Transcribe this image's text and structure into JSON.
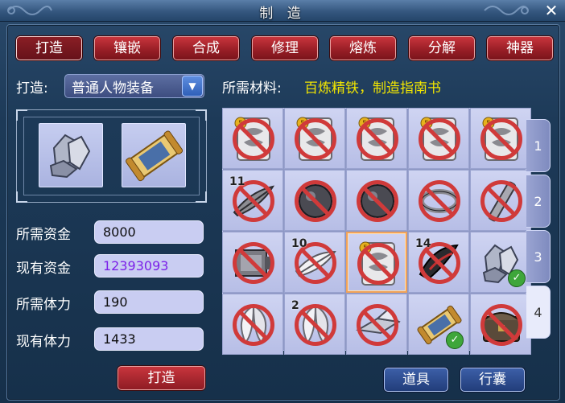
{
  "window": {
    "title": "制 造",
    "close_glyph": "✕"
  },
  "tabs": [
    {
      "label": "打造",
      "active": true
    },
    {
      "label": "镶嵌",
      "active": false
    },
    {
      "label": "合成",
      "active": false
    },
    {
      "label": "修理",
      "active": false
    },
    {
      "label": "熔炼",
      "active": false
    },
    {
      "label": "分解",
      "active": false
    },
    {
      "label": "神器",
      "active": false
    }
  ],
  "forge": {
    "type_label": "打造:",
    "type_value": "普通人物装备",
    "dropdown_icon": "chevron-down-icon",
    "materials_label": "所需材料:",
    "materials_value": "百炼精铁，制造指南书",
    "material_slots": [
      {
        "item": "refined-iron-icon"
      },
      {
        "item": "manufacturing-guide-scroll-icon"
      }
    ]
  },
  "stats": [
    {
      "label": "所需资金",
      "value": "8000",
      "color": "#0d0d0d"
    },
    {
      "label": "现有资金",
      "value": "12393093",
      "color": "#7b1fe8"
    },
    {
      "label": "所需体力",
      "value": "190",
      "color": "#0d0d0d"
    },
    {
      "label": "现有体力",
      "value": "1433",
      "color": "#0d0d0d"
    }
  ],
  "inventory": {
    "pages": [
      "1",
      "2",
      "3",
      "4"
    ],
    "active_page": "4",
    "rows": [
      [
        {
          "item": "medal-card-icon",
          "blocked": true,
          "count": ""
        },
        {
          "item": "medal-card-icon",
          "blocked": true,
          "count": ""
        },
        {
          "item": "medal-card-icon",
          "blocked": true,
          "count": ""
        },
        {
          "item": "medal-card-icon",
          "blocked": true,
          "count": ""
        },
        {
          "item": "medal-card-icon",
          "blocked": true,
          "count": ""
        }
      ],
      [
        {
          "item": "feather-icon",
          "blocked": true,
          "count": "11"
        },
        {
          "item": "dark-orb-icon",
          "blocked": true,
          "count": ""
        },
        {
          "item": "dark-orb-icon",
          "blocked": true,
          "count": ""
        },
        {
          "item": "bracelet-icon",
          "blocked": true,
          "count": ""
        },
        {
          "item": "metal-bar-icon",
          "blocked": true,
          "count": ""
        }
      ],
      [
        {
          "item": "machine-part-icon",
          "blocked": true,
          "count": ""
        },
        {
          "item": "white-feather-icon",
          "blocked": true,
          "count": "10"
        },
        {
          "item": "medal-card-icon",
          "blocked": true,
          "count": "",
          "selected": true
        },
        {
          "item": "black-claw-icon",
          "blocked": true,
          "count": "14"
        },
        {
          "item": "refined-iron-icon",
          "blocked": false,
          "count": "",
          "checked": true
        }
      ],
      [
        {
          "item": "silver-leaf-icon",
          "blocked": true,
          "count": ""
        },
        {
          "item": "silver-leaf-icon",
          "blocked": true,
          "count": "2"
        },
        {
          "item": "crystal-shard-icon",
          "blocked": true,
          "count": ""
        },
        {
          "item": "manufacturing-guide-scroll-icon",
          "blocked": false,
          "count": "",
          "checked": true
        },
        {
          "item": "treasure-chest-icon",
          "blocked": true,
          "count": ""
        }
      ]
    ]
  },
  "buttons": {
    "forge": "打造",
    "items": "道具",
    "bag": "行囊"
  },
  "colors": {
    "accent_red": "#a8232b",
    "material_text": "#f2e600",
    "funds_text": "#7b1fe8"
  }
}
